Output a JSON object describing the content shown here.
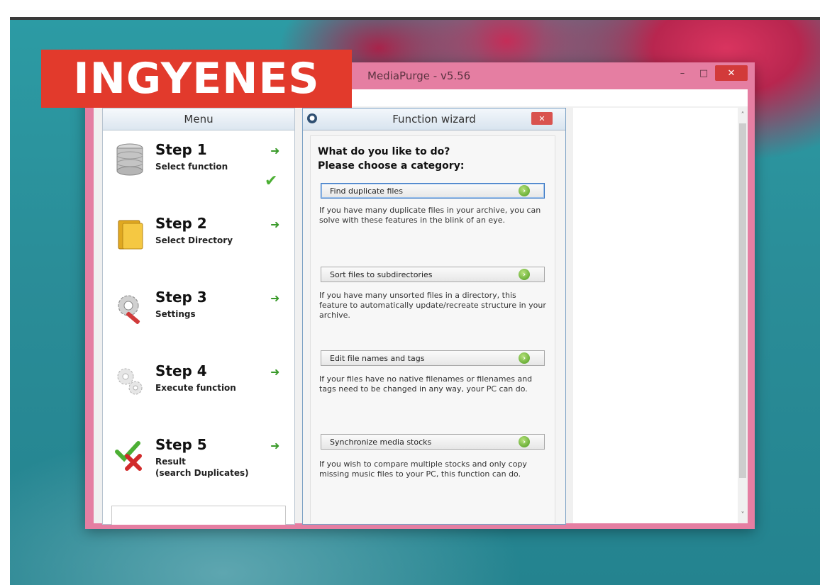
{
  "banner": {
    "text": "INGYENES"
  },
  "window": {
    "title": "MediaPurge - v5.56",
    "controls": {
      "minimize": "–",
      "maximize": "□",
      "close": "✕"
    }
  },
  "menu": {
    "header": "Menu",
    "steps": [
      {
        "title": "Step 1",
        "subtitle": "Select function",
        "icon": "database-icon",
        "done": true
      },
      {
        "title": "Step 2",
        "subtitle": "Select Directory",
        "icon": "folder-icon",
        "done": false
      },
      {
        "title": "Step 3",
        "subtitle": "Settings",
        "icon": "gear-wrench-icon",
        "done": false
      },
      {
        "title": "Step 4",
        "subtitle": "Execute function",
        "icon": "gears-icon",
        "done": false
      },
      {
        "title": "Step 5",
        "subtitle_line1": "Result",
        "subtitle_line2": "(search Duplicates)",
        "icon": "check-cross-icon",
        "done": false
      }
    ],
    "arrow_glyph": "➜",
    "check_glyph": "✔"
  },
  "wizard": {
    "title": "Function wizard",
    "question_line1": "What do you like to do?",
    "question_line2": "Please choose a category:",
    "options": [
      {
        "label": "Find duplicate files",
        "description": "If you have many duplicate files in your archive, you can solve with these features in the blink of an eye."
      },
      {
        "label": "Sort files to subdirectories",
        "description": "If you have many unsorted files in a directory, this feature to automatically update/recreate structure in your archive."
      },
      {
        "label": "Edit file names and tags",
        "description": "If your files have no native filenames or filenames and tags need to be changed in any way, your PC can do."
      },
      {
        "label": "Synchronize media stocks",
        "description": "If you wish to compare multiple stocks and only copy missing music files to your PC, this function can do."
      }
    ]
  },
  "scrollbar": {
    "up": "˄",
    "down": "˅"
  }
}
